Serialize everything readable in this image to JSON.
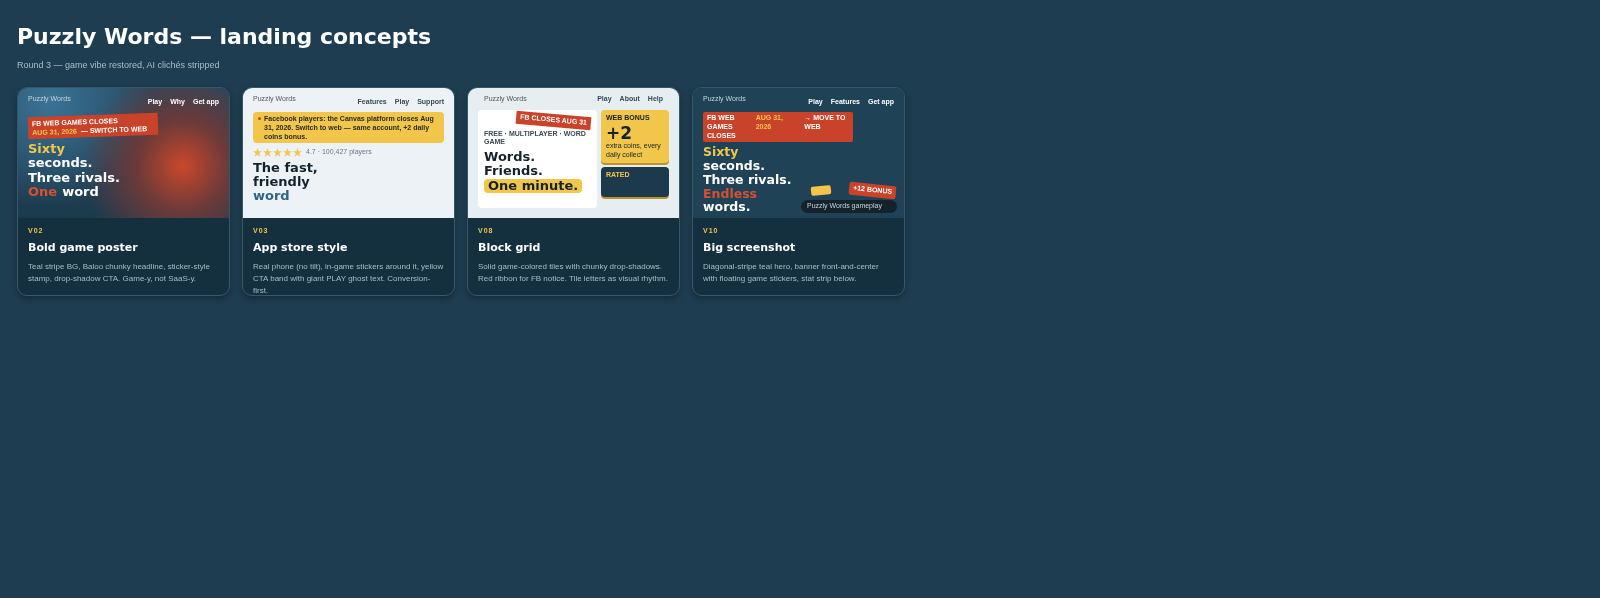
{
  "page": {
    "title": "Puzzly Words — landing concepts",
    "subtitle": "Round 3 — game vibe restored, AI clichés stripped"
  },
  "concepts": [
    {
      "tag": "V02",
      "title": "Bold game poster",
      "description": "Teal stripe BG, Baloo chunky headline, sticker-style stamp, drop-shadow CTA. Game-y, not SaaS-y.",
      "preview": {
        "kind": "poster",
        "logo": "Puzzly Words",
        "nav": [
          "Play",
          "Why",
          "Get app"
        ],
        "banner": [
          "FB WEB GAMES CLOSES",
          "AUG 31, 2026",
          "— SWITCH TO WEB"
        ],
        "headline": [
          [
            {
              "text": "Sixty",
              "color": "#f2c64a"
            }
          ],
          [
            {
              "text": "seconds.",
              "color": "#ffffff"
            }
          ],
          [
            {
              "text": "Three rivals.",
              "color": "#ffffff"
            }
          ],
          [
            {
              "text": "One",
              "color": "#d9502f"
            },
            {
              "text": "word",
              "color": "#ffffff"
            }
          ]
        ]
      }
    },
    {
      "tag": "V03",
      "title": "App store style",
      "description": "Real phone (no tilt), in-game stickers around it, yellow CTA band with giant PLAY ghost text. Conversion-first.",
      "preview": {
        "kind": "appstore",
        "logo": "Puzzly Words",
        "nav": [
          "Features",
          "Play",
          "Support"
        ],
        "notice": "Facebook players: the Canvas platform closes Aug 31, 2026. Switch to web — same account, +2 daily coins bonus.",
        "stars": 5,
        "rating": "4.7 · 100,427 players",
        "headline": [
          [
            {
              "text": "The fast,",
              "color": "#14222c"
            }
          ],
          [
            {
              "text": "friendly",
              "color": "#14222c"
            }
          ],
          [
            {
              "text": "word",
              "color": "#2f6482"
            }
          ]
        ]
      }
    },
    {
      "tag": "V08",
      "title": "Block grid",
      "description": "Solid game-colored tiles with chunky drop-shadows. Red ribbon for FB notice. Tile letters as visual rhythm.",
      "preview": {
        "kind": "grid",
        "logo": "Puzzly Words",
        "nav": [
          "Play",
          "About",
          "Help"
        ],
        "eyebrow": "FREE · MULTIPLAYER · WORD GAME",
        "ribbon": "FB CLOSES AUG 31",
        "headline": [
          [
            {
              "text": "Words.",
              "color": "#14222c"
            }
          ],
          [
            {
              "text": "Friends.",
              "color": "#14222c"
            }
          ],
          [
            {
              "text": "One minute.",
              "highlighted": true
            }
          ]
        ],
        "tiles": [
          {
            "label": "WEB BONUS",
            "value": "+2",
            "caption": "extra coins, every daily collect"
          },
          {
            "label": "RATED"
          }
        ]
      }
    },
    {
      "tag": "V10",
      "title": "Big screenshot",
      "description": "Diagonal-stripe teal hero, banner front-and-center with floating game stickers, stat strip below.",
      "preview": {
        "kind": "screenshot",
        "logo": "Puzzly Words",
        "nav": [
          "Play",
          "Features",
          "Get app"
        ],
        "banner": [
          "FB WEB GAMES CLOSES",
          "AUG 31, 2026",
          "→ MOVE TO WEB"
        ],
        "headline": [
          [
            {
              "text": "Sixty",
              "color": "#f2c64a"
            }
          ],
          [
            {
              "text": "seconds.",
              "color": "#ffffff"
            }
          ],
          [
            {
              "text": "Three rivals.",
              "color": "#ffffff"
            }
          ],
          [
            {
              "text": "Endless",
              "color": "#d9502f"
            }
          ],
          [
            {
              "text": "words.",
              "color": "#ffffff"
            }
          ]
        ],
        "screenshot": "Puzzly Words gameplay",
        "sticker": "+12 BONUS"
      }
    }
  ]
}
